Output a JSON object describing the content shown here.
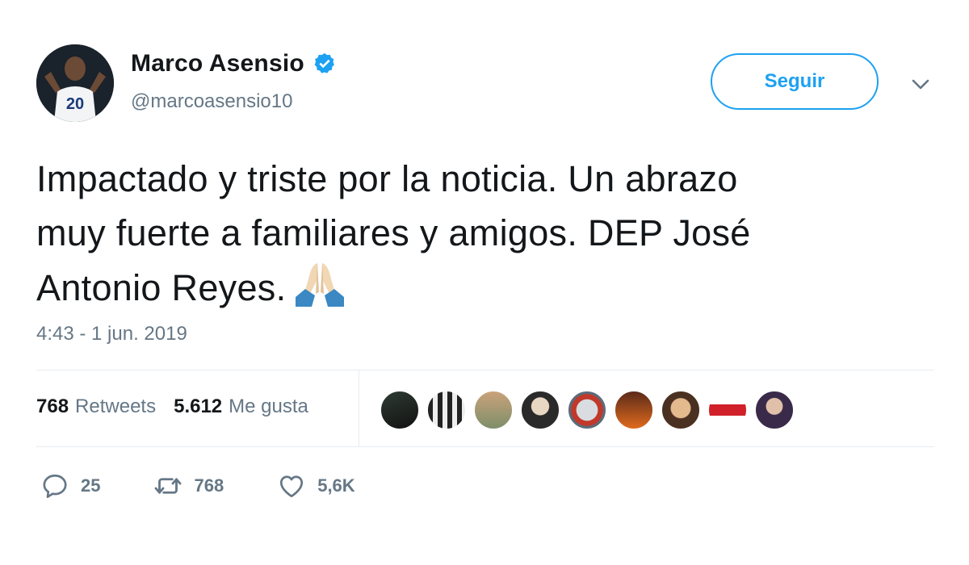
{
  "user": {
    "display_name": "Marco Asensio",
    "handle": "@marcoasensio10",
    "verified": true,
    "avatar_jersey_number": "20"
  },
  "follow_button_label": "Seguir",
  "tweet": {
    "text_lines": [
      "Impactado y triste por la noticia. Un abrazo",
      "muy fuerte a familiares y amigos. DEP José",
      "Antonio Reyes."
    ],
    "emoji": "folded-hands-icon",
    "timestamp": "4:43 - 1 jun. 2019"
  },
  "stats": {
    "retweets_count": "768",
    "retweets_label": "Retweets",
    "likes_count": "5.612",
    "likes_label": "Me gusta"
  },
  "likers_avatars": 9,
  "actions": {
    "reply_count": "25",
    "retweet_count": "768",
    "like_count": "5,6K"
  },
  "colors": {
    "accent": "#1da1f2",
    "secondary_text": "#657786",
    "primary_text": "#14171a",
    "divider": "#e6ecf0"
  }
}
